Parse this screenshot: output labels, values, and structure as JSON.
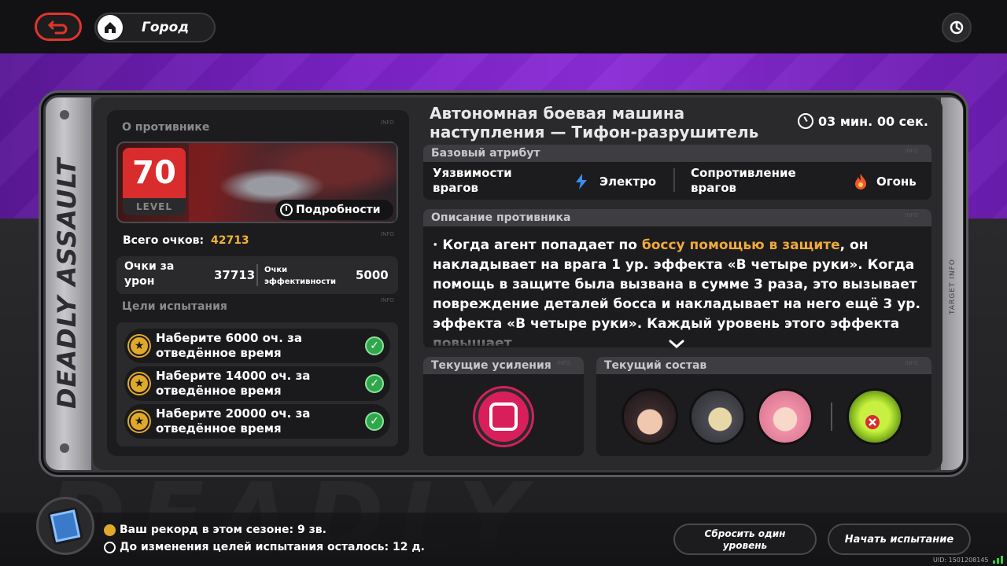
{
  "topbar": {
    "back_icon": "return-arrow-icon",
    "city_label": "Город",
    "home_icon": "home-icon",
    "power_icon": "power-icon"
  },
  "side_text": "DEADLY ASSAULT",
  "right_text": "TARGET INFO",
  "enemy_info": {
    "section_title": "О противнике",
    "info_tag": "INFO",
    "level": "70",
    "level_label": "LEVEL",
    "details_label": "Подробности",
    "total_label": "Всего очков:",
    "total_value": "42713",
    "damage_label": "Очки за урон",
    "damage_value": "37713",
    "efficiency_label": "Очки эффективности",
    "efficiency_value": "5000"
  },
  "goals": {
    "section_title": "Цели испытания",
    "items": [
      {
        "text_line1": "Наберите 6000 оч. за",
        "text_line2": "отведённое время",
        "completed": true
      },
      {
        "text_line1": "Наберите 14000 оч. за",
        "text_line2": "отведённое время",
        "completed": true
      },
      {
        "text_line1": "Наберите 20000 оч. за",
        "text_line2": "отведённое время",
        "completed": true
      }
    ]
  },
  "boss": {
    "title_line1": "Автономная боевая машина",
    "title_line2": "наступления — Тифон-разрушитель",
    "timer": "03 мин. 00 сек."
  },
  "attributes": {
    "header": "Базовый атрибут",
    "weakness_label_1": "Уязвимости",
    "weakness_label_2": "врагов",
    "weakness_value": "Электро",
    "resist_label_1": "Сопротивление",
    "resist_label_2": "врагов",
    "resist_value": "Огонь",
    "electro_color": "#3a8ef0",
    "fire_color": "#f0572a"
  },
  "description": {
    "header": "Описание противника",
    "pre": "· Когда агент попадает по ",
    "highlight": "боссу помощью в защите",
    "post": ", он накладывает на врага 1 ур. эффекта «В четыре руки». Когда помощь в защите была вызвана в сумме 3 раза, это вызывает повреждение деталей босса и накладывает на него ещё 3 ур. эффекта «В четыре руки». Каждый уровень этого эффекта повышает",
    "highlight_color": "#f0a93a"
  },
  "buffs": {
    "header": "Текущие усиления",
    "icon": "fist-buff-icon",
    "color": "#d81f5c"
  },
  "team": {
    "header": "Текущий состав"
  },
  "bottom": {
    "record": "Ваш рекорд в этом сезоне: 9 зв.",
    "reset_timer": "До изменения целей испытания осталось:  12 д.",
    "reset_line1": "Сбросить один",
    "reset_line2": "уровень",
    "start_label": "Начать испытание",
    "uid": "UID: 1501208145"
  }
}
